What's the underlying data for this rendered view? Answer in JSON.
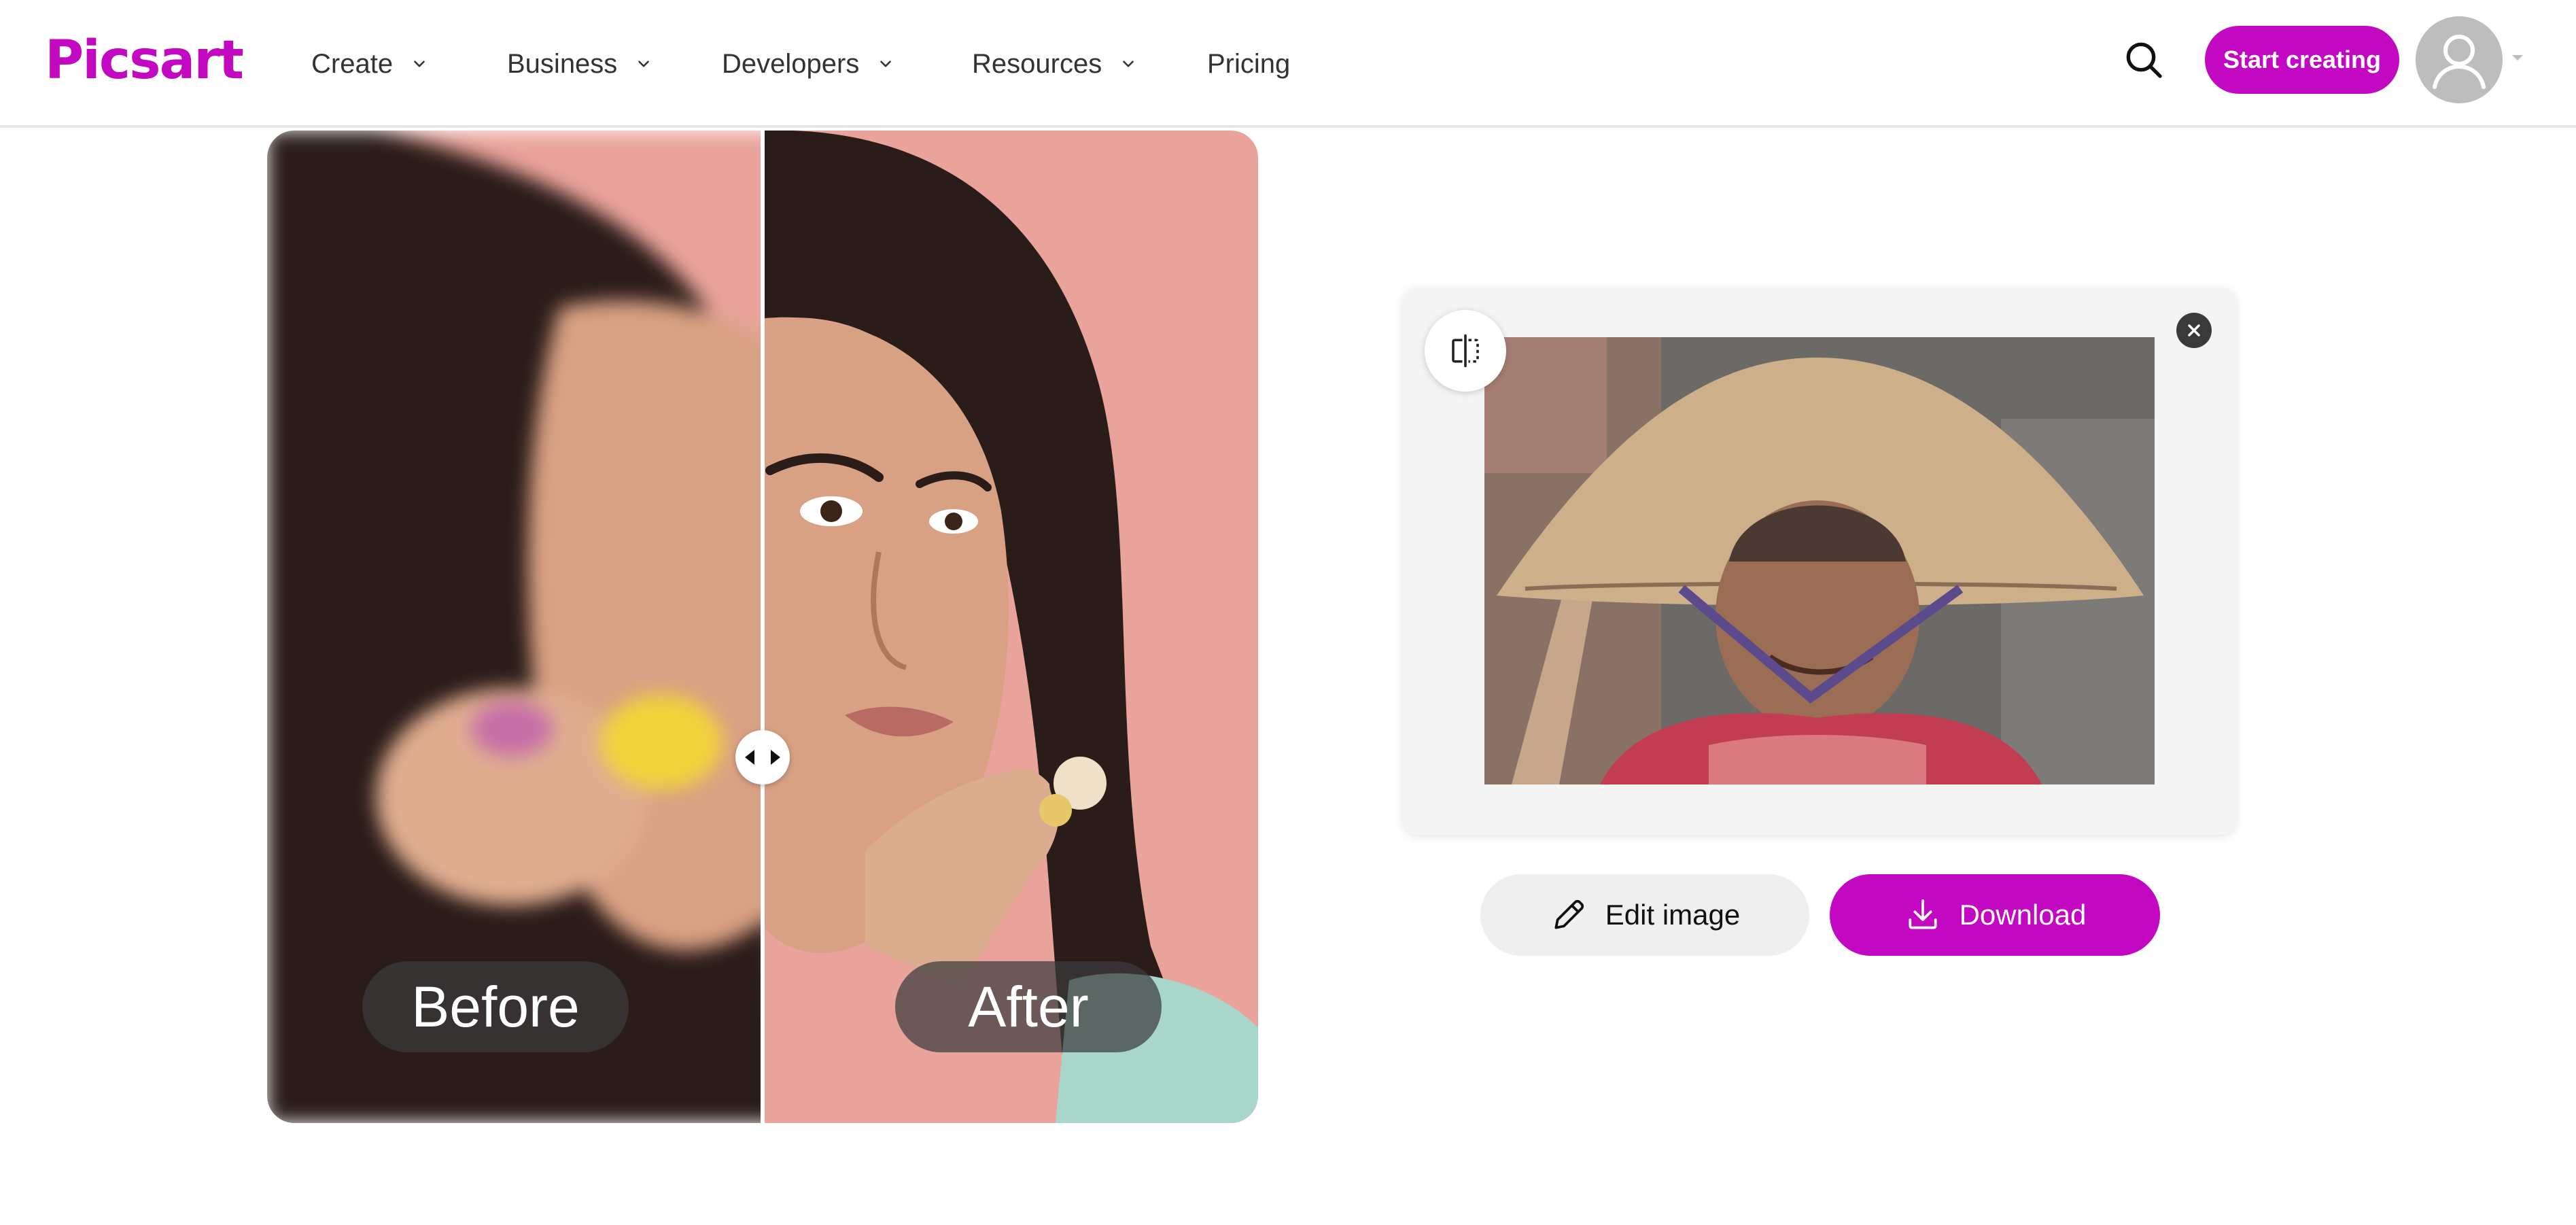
{
  "header": {
    "logo": "Picsart",
    "nav": [
      {
        "label": "Create",
        "has_dropdown": true
      },
      {
        "label": "Business",
        "has_dropdown": true
      },
      {
        "label": "Developers",
        "has_dropdown": true
      },
      {
        "label": "Resources",
        "has_dropdown": true
      },
      {
        "label": "Pricing",
        "has_dropdown": false
      }
    ],
    "search_icon": "search-icon",
    "cta_label": "Start creating",
    "avatar_icon": "user-avatar-icon"
  },
  "compare": {
    "before_label": "Before",
    "after_label": "After",
    "slider_position": 0.5
  },
  "result": {
    "compare_icon": "split-compare-icon",
    "close_icon": "close-icon",
    "edit_label": "Edit image",
    "download_label": "Download"
  },
  "colors": {
    "brand": "#c209c1",
    "header_border": "#e6e6e6",
    "card_bg": "#f4f4f4",
    "photo_bg_pink": "#e9a39b"
  }
}
